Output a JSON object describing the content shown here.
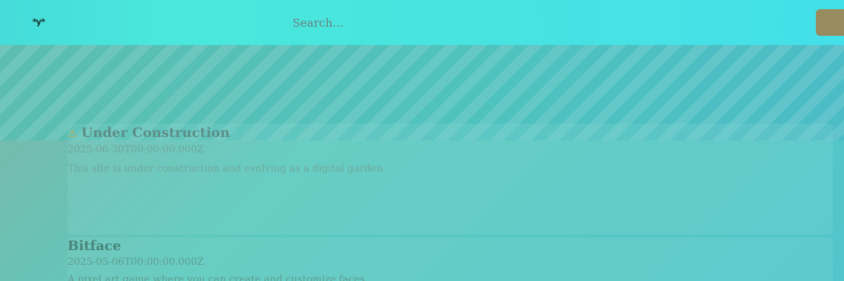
{
  "header": {
    "logo_text": "*y*",
    "search_placeholder": "Search...",
    "menu_button_color": "#988b5e"
  },
  "posts": [
    {
      "icon": "warning-icon",
      "icon_glyph": "⚠",
      "title": "Under Construction",
      "date": "2025-06-30T00:00:00.000Z",
      "description": "This site is under construction and evolving as a digital garden."
    },
    {
      "title": "Bitface",
      "date": "2025-05-06T00:00:00.000Z",
      "description": "A pixel art game where you can create and customize faces."
    }
  ],
  "colors": {
    "header_bg": "#47e3e1",
    "body_bg": "#5ec9bd",
    "accent": "#988b5e"
  }
}
